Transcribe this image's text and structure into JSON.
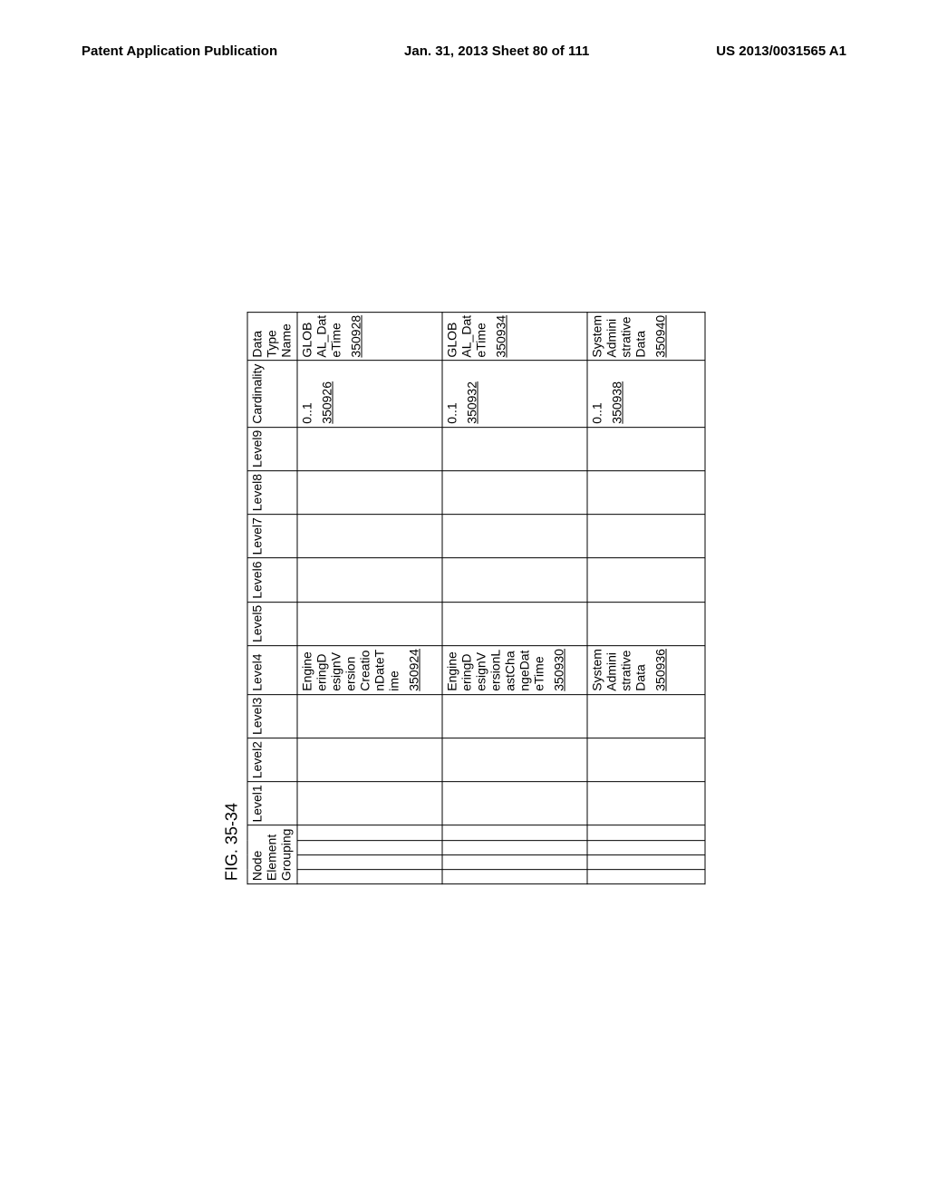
{
  "header": {
    "left": "Patent Application Publication",
    "center": "Jan. 31, 2013  Sheet 80 of 111",
    "right": "US 2013/0031565 A1"
  },
  "figure_label": "FIG. 35-34",
  "columns": {
    "neg": "Node Element Grouping",
    "l1": "Level1",
    "l2": "Level2",
    "l3": "Level3",
    "l4": "Level4",
    "l5": "Level5",
    "l6": "Level6",
    "l7": "Level7",
    "l8": "Level8",
    "l9": "Level9",
    "card": "Cardinality",
    "dtn": "Data Type Name"
  },
  "rows": [
    {
      "level4": "EngineeringDesignVersionCreationDateTime",
      "level4_ref": "350924",
      "cardinality": "0..1",
      "cardinality_ref": "350926",
      "dtn": "GLOBAL_DateTime",
      "dtn_ref": "350928"
    },
    {
      "level4": "EngineeringDesignVersionLastChangeDateTime",
      "level4_ref": "350930",
      "cardinality": "0..1",
      "cardinality_ref": "350932",
      "dtn": "GLOBAL_DateTime",
      "dtn_ref": "350934"
    },
    {
      "level4": "SystemAdministrativeData",
      "level4_ref": "350936",
      "cardinality": "0..1",
      "cardinality_ref": "350938",
      "dtn": "SystemAdministrativeData",
      "dtn_ref": "350940"
    }
  ]
}
